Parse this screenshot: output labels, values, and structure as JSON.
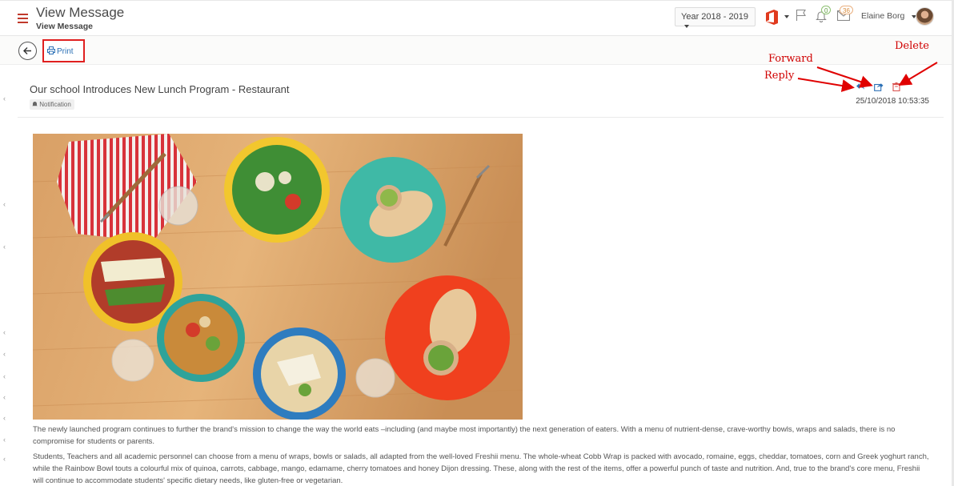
{
  "header": {
    "title": "View Message",
    "subtitle": "View Message",
    "year_selector": "Year 2018 - 2019",
    "notifications_count": "0",
    "messages_count": "36",
    "user_name": "Elaine Borg"
  },
  "toolbar": {
    "print_label": "Print"
  },
  "message": {
    "subject": "Our school Introduces New Lunch Program - Restaurant",
    "tag": "Notification",
    "date": "25/10/2018 10:53:35",
    "paragraphs": [
      "The newly launched program continues to further the brand's mission to change the way the world eats –including (and maybe most importantly) the next generation of eaters. With a menu of nutrient-dense, crave-worthy bowls, wraps and salads, there is no compromise for students or parents.",
      "Students, Teachers and all academic personnel can choose from a menu of wraps, bowls or salads, all adapted from the well-loved Freshii menu. The whole-wheat Cobb Wrap is packed with avocado, romaine, eggs, cheddar, tomatoes, corn and Greek yoghurt ranch, while the Rainbow Bowl touts a colourful mix of quinoa, carrots, cabbage, mango, edamame, cherry tomatoes and honey Dijon dressing. These, along with the rest of the items, offer a powerful punch of taste and nutrition. And, true to the brand's core menu, Freshii will continue to accommodate students' specific dietary needs, like gluten-free or vegetarian."
    ]
  },
  "annotations": {
    "forward": "Forward",
    "reply": "Reply",
    "delete": "Delete"
  },
  "colors": {
    "accent": "#2a6fb5",
    "annotation": "#d00000",
    "highlight_box": "#e02020"
  }
}
